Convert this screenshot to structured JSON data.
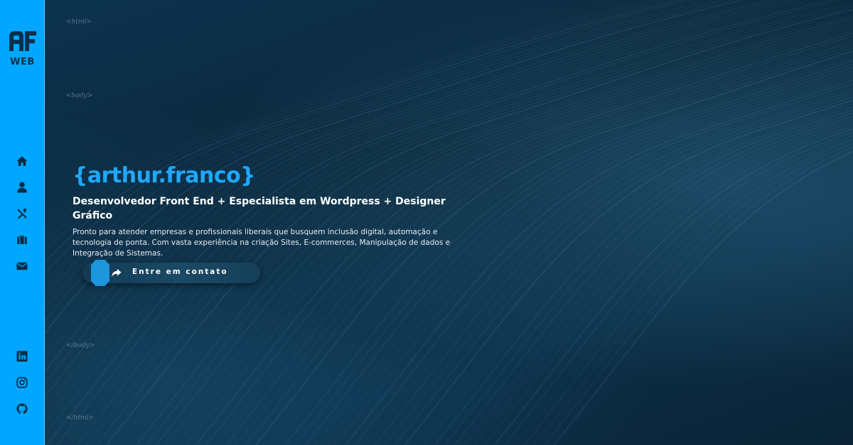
{
  "brand": {
    "logo_text": "WEB",
    "logo_mark": "AF"
  },
  "sidebar": {
    "nav": [
      {
        "icon": "home-icon"
      },
      {
        "icon": "user-icon"
      },
      {
        "icon": "tools-icon"
      },
      {
        "icon": "briefcase-icon"
      },
      {
        "icon": "envelope-icon"
      }
    ],
    "social": [
      {
        "icon": "linkedin-icon"
      },
      {
        "icon": "instagram-icon"
      },
      {
        "icon": "github-icon"
      }
    ]
  },
  "code_tags": {
    "html_open": "<html>",
    "body_open": "<body>",
    "body_close": "</body>",
    "html_close": "</html>"
  },
  "hero": {
    "name": "{arthur.franco}",
    "role": "Desenvolvedor Front End + Especialista em Wordpress + Designer Gráfico",
    "description": "Pronto para atender empresas e profissionais liberais que busquem inclusão digital, automação e tecnologia de ponta. Com vasta experiência na criação Sites, E-commerces, Manipulação de dados e Integração de Sistemas.",
    "cta_label": "Entre em contato"
  },
  "colors": {
    "sidebar": "#00a6ff",
    "accent": "#1fa8ff",
    "background": "#0b2a3f"
  }
}
